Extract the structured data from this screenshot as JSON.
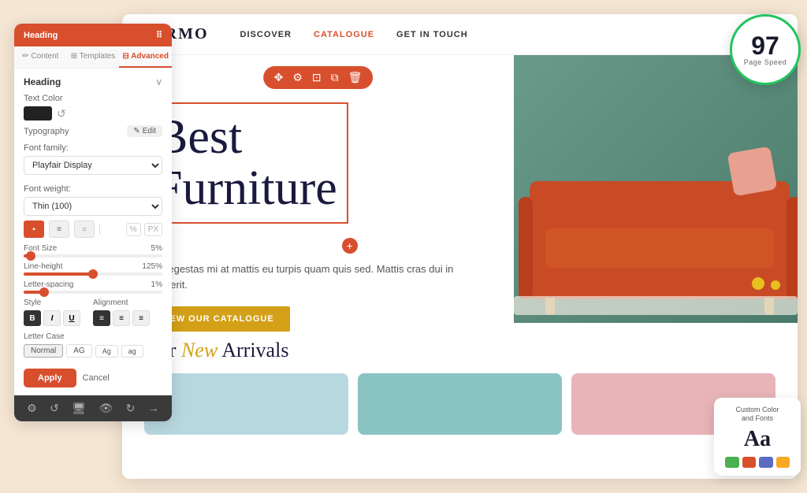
{
  "panel": {
    "header_label": "Heading",
    "tabs": [
      {
        "id": "content",
        "label": "Content",
        "icon": "✏️"
      },
      {
        "id": "templates",
        "label": "Templates",
        "icon": "🔲"
      },
      {
        "id": "advanced",
        "label": "Advanced",
        "icon": "⊞"
      }
    ],
    "active_tab": "advanced",
    "heading_label": "Heading",
    "text_color_label": "Text Color",
    "typography_label": "Typography",
    "edit_label": "Edit",
    "font_family_label": "Font family:",
    "font_family_value": "Playfair Display",
    "font_weight_label": "Font weight:",
    "font_weight_value": "Thin (100)",
    "font_size_label": "Font Size",
    "font_size_value": "5%",
    "line_height_label": "Line-height",
    "line_height_value": "125%",
    "letter_spacing_label": "Letter-spacing",
    "letter_spacing_value": "1%",
    "style_label": "Style",
    "alignment_label": "Alignment",
    "letter_case_label": "Letter Case",
    "letter_case_normal": "Normal",
    "letter_case_ag1": "AG",
    "letter_case_ag2": "Ag",
    "letter_case_ag3": "ag",
    "apply_label": "Apply",
    "cancel_label": "Cancel",
    "percent_label": "%",
    "px_label": "PX",
    "slider_font_pct": 5,
    "slider_line_pct": 50,
    "slider_letter_pct": 15
  },
  "nav": {
    "logo": "FURMO",
    "links": [
      {
        "label": "DISCOVER"
      },
      {
        "label": "CATALOGUE"
      },
      {
        "label": "GET IN TOUCH"
      }
    ]
  },
  "hero": {
    "heading_line1": "Best",
    "heading_line2": "Furniture",
    "subtext": "Eget egestas mi at mattis eu turpis quam quis sed. Mattis cras dui in hendrerit.",
    "cta_label": "VIEW OUR CATALOGUE",
    "toolbar_icons": [
      "✥",
      "⚙",
      "⊡",
      "⧉",
      "🗑"
    ]
  },
  "arrivals": {
    "title_prefix": "Our ",
    "title_highlight": "New",
    "title_suffix": " Arrivals"
  },
  "speed_badge": {
    "number": "97",
    "label": "Page Speed"
  },
  "custom_color": {
    "title": "Custom Color\nand Fonts",
    "aa": "Aa",
    "colors": [
      "#4caf50",
      "#d84f2e",
      "#5c6bc0",
      "#f9a825"
    ]
  },
  "footer_icons": [
    "⚙",
    "↺",
    "🖥",
    "👁",
    "↺",
    "→"
  ]
}
